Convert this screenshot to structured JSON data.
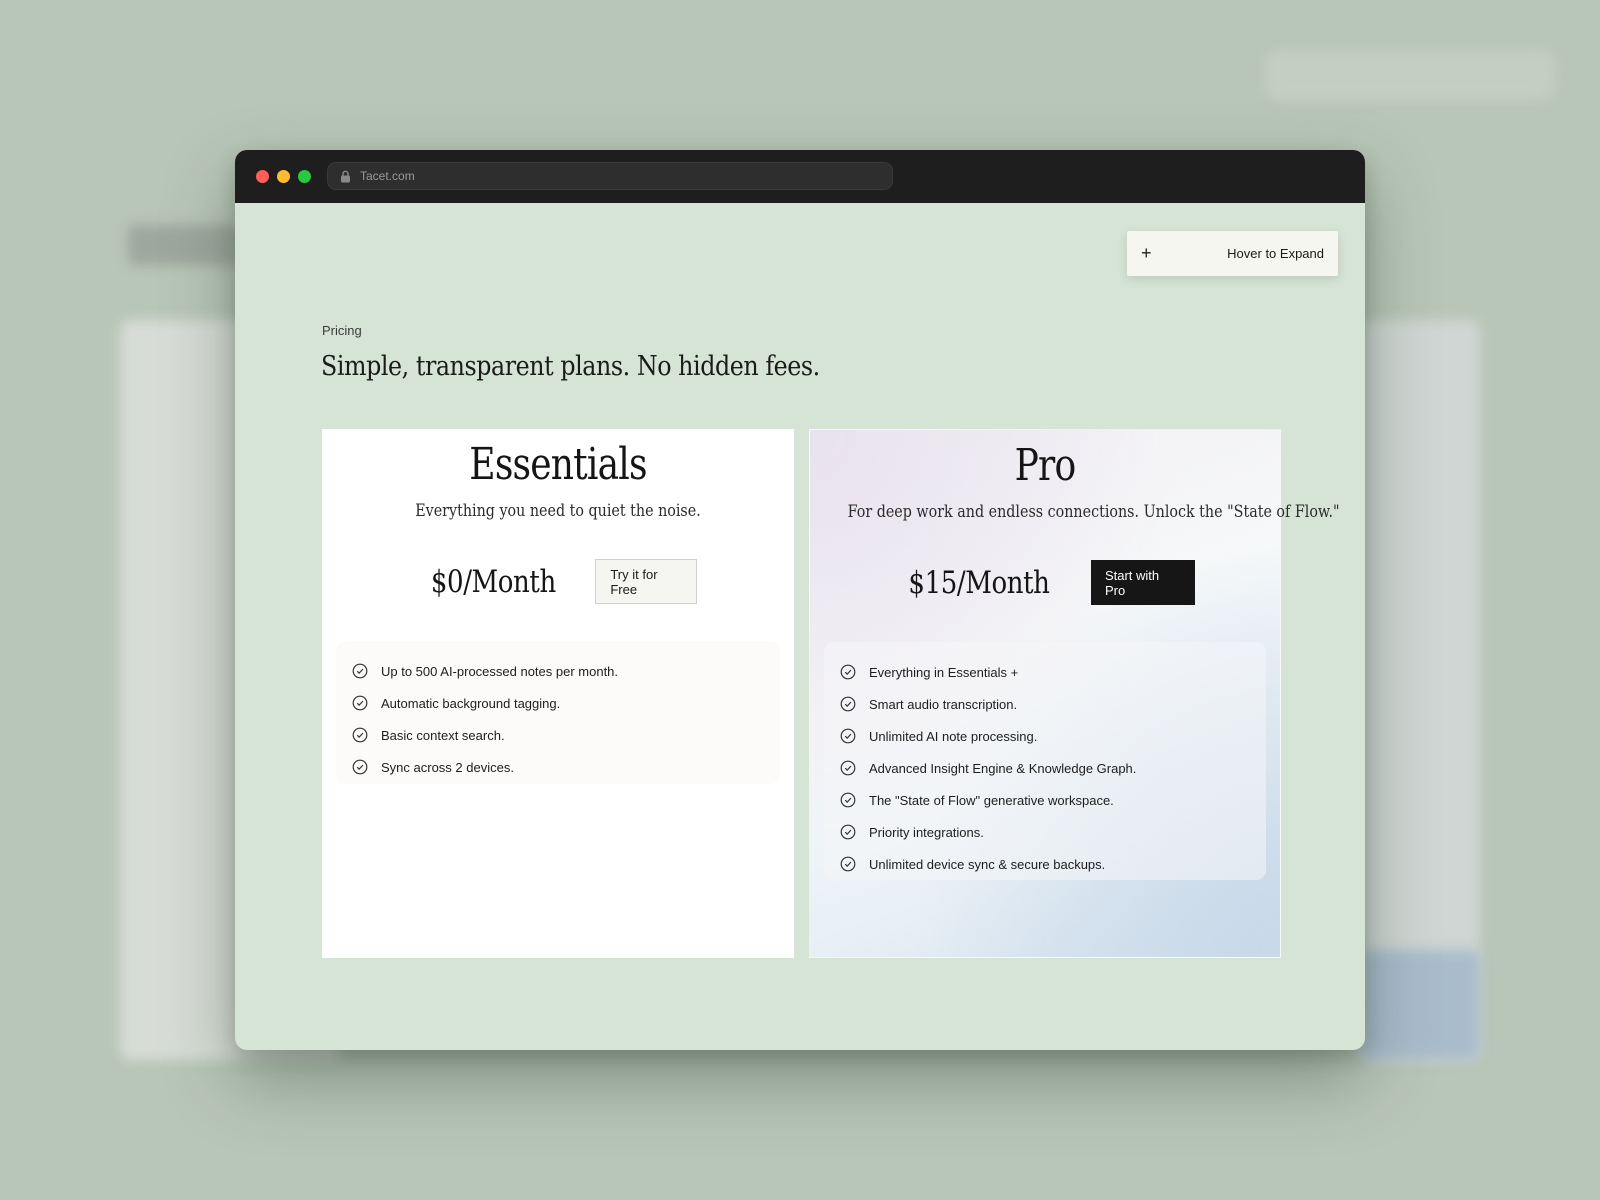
{
  "browser": {
    "url": "Tacet.com"
  },
  "expand_button": {
    "icon": "plus-icon",
    "label": "Hover to Expand"
  },
  "pricing": {
    "eyebrow": "Pricing",
    "headline": "Simple, transparent plans. No hidden fees.",
    "plans": [
      {
        "name": "Essentials",
        "description": "Everything you need to quiet the noise.",
        "price": "$0/Month",
        "cta": "Try it for Free",
        "features": [
          "Up to 500 AI-processed notes per month.",
          "Automatic background tagging.",
          "Basic context search.",
          "Sync across 2 devices."
        ]
      },
      {
        "name": "Pro",
        "description": "For deep work and endless connections. Unlock the \"State of Flow.\"",
        "price": "$15/Month",
        "cta": "Start with Pro",
        "features": [
          "Everything in Essentials +",
          "Smart audio transcription.",
          "Unlimited AI note processing.",
          "Advanced Insight Engine & Knowledge Graph.",
          "The \"State of Flow\" generative workspace.",
          "Priority integrations.",
          "Unlimited device sync & secure backups."
        ]
      }
    ]
  },
  "colors": {
    "page_bg": "#b8c6b7",
    "content_bg": "#d6e4d5",
    "titlebar": "#1e1e1e",
    "dark_button": "#161616"
  }
}
